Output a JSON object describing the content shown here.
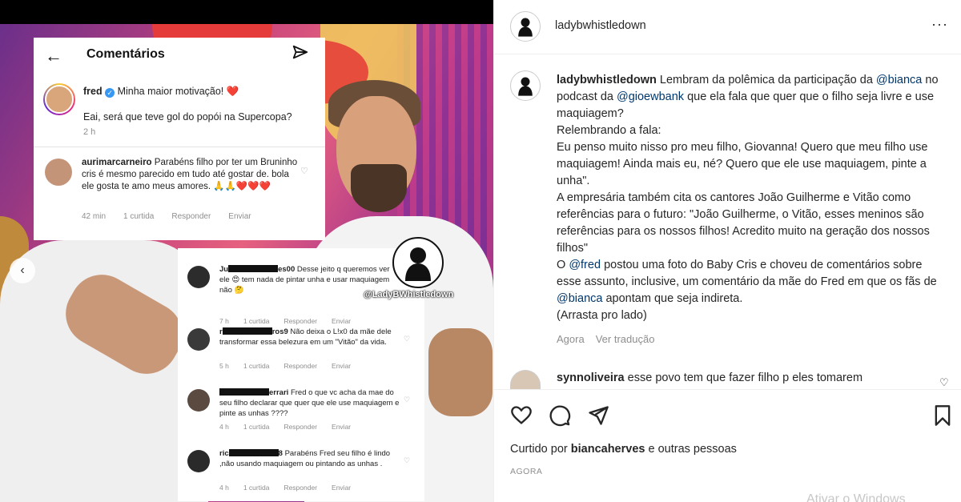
{
  "photo_card_top": {
    "title": "Comentários",
    "caption_user": "fred",
    "caption_text": "Minha maior motivação! ❤️",
    "question": "Eai, será que teve gol do popói na Supercopa?",
    "time": "2 h",
    "comment": {
      "user": "aurimarcarneiro",
      "text": "Parabéns filho por ter um Bruninho cris é mesmo parecido em tudo até gostar de. bola ele gosta te amo meus amores. 🙏🙏❤️❤️❤️",
      "time": "42 min",
      "likes": "1 curtida",
      "reply": "Responder",
      "send": "Enviar"
    }
  },
  "photo_card_bottom": {
    "comments": [
      {
        "user_prefix": "Ju",
        "user_suffix": "es00",
        "text": "Desse jeito q queremos ver ele 😍 tem nada de pintar unha e usar maquiagem não 🤔",
        "time": "7 h",
        "likes": "1 curtida",
        "reply": "Responder",
        "send": "Enviar"
      },
      {
        "user_prefix": "r",
        "user_suffix": "ros9",
        "text": "Não deixa o L!x0 da mãe dele transformar essa belezura em um \"Vitão\" da vida.",
        "time": "5 h",
        "likes": "1 curtida",
        "reply": "Responder",
        "send": "Enviar"
      },
      {
        "user_prefix": "",
        "user_suffix": "errari",
        "text": "Fred o que vc acha da mae do seu filho declarar que quer que ele use maquiagem e pinte as unhas ????",
        "time": "4 h",
        "likes": "1 curtida",
        "reply": "Responder",
        "send": "Enviar"
      },
      {
        "user_prefix": "ric",
        "user_suffix": "8",
        "text": "Parabéns Fred seu filho é lindo ,não usando maquiagem ou pintando as unhas .",
        "time": "4 h",
        "likes": "1 curtida",
        "reply": "Responder",
        "send": "Enviar"
      }
    ]
  },
  "watermark": "@LadyBWhistledown",
  "post": {
    "username": "ladybwhistledown",
    "more": "···",
    "caption_user": "ladybwhistledown",
    "caption_parts": {
      "p1": "Lembram da polêmica da participação da",
      "m1": "@bianca",
      "p2": "no podcast da",
      "m2": "@gioewbank",
      "p3": "que ela fala que quer que o filho seja livre e use maquiagem?",
      "l2": "Relembrando a fala:",
      "l3": "Eu penso muito nisso pro meu filho, Giovanna! Quero que meu filho use maquiagem! Ainda mais eu, né? Quero que ele use maquiagem, pinte a unha\".",
      "l4": "A empresária também cita os cantores João Guilherme e Vitão como referências para o futuro: \"João Guilherme, o Vitão, esses meninos são referências para os nossos filhos! Acredito muito na geração dos nossos filhos\"",
      "l5a": "O",
      "m3": "@fred",
      "l5b": "postou uma foto do Baby Cris e choveu de comentários sobre esse assunto, inclusive, um comentário da mãe do Fred em que os fãs de",
      "m4": "@bianca",
      "l5c": "apontam que seja indireta.",
      "l6": "(Arrasta pro lado)"
    },
    "caption_time": "Agora",
    "see_translation": "Ver tradução",
    "next_comment_user": "synnoliveira",
    "next_comment_text": "esse povo tem que fazer filho p eles tomarem",
    "liked_prefix": "Curtido por",
    "liked_user": "biancaherves",
    "liked_suffix": "e outras pessoas",
    "when": "AGORA",
    "windows_watermark": "Ativar o Windows"
  }
}
